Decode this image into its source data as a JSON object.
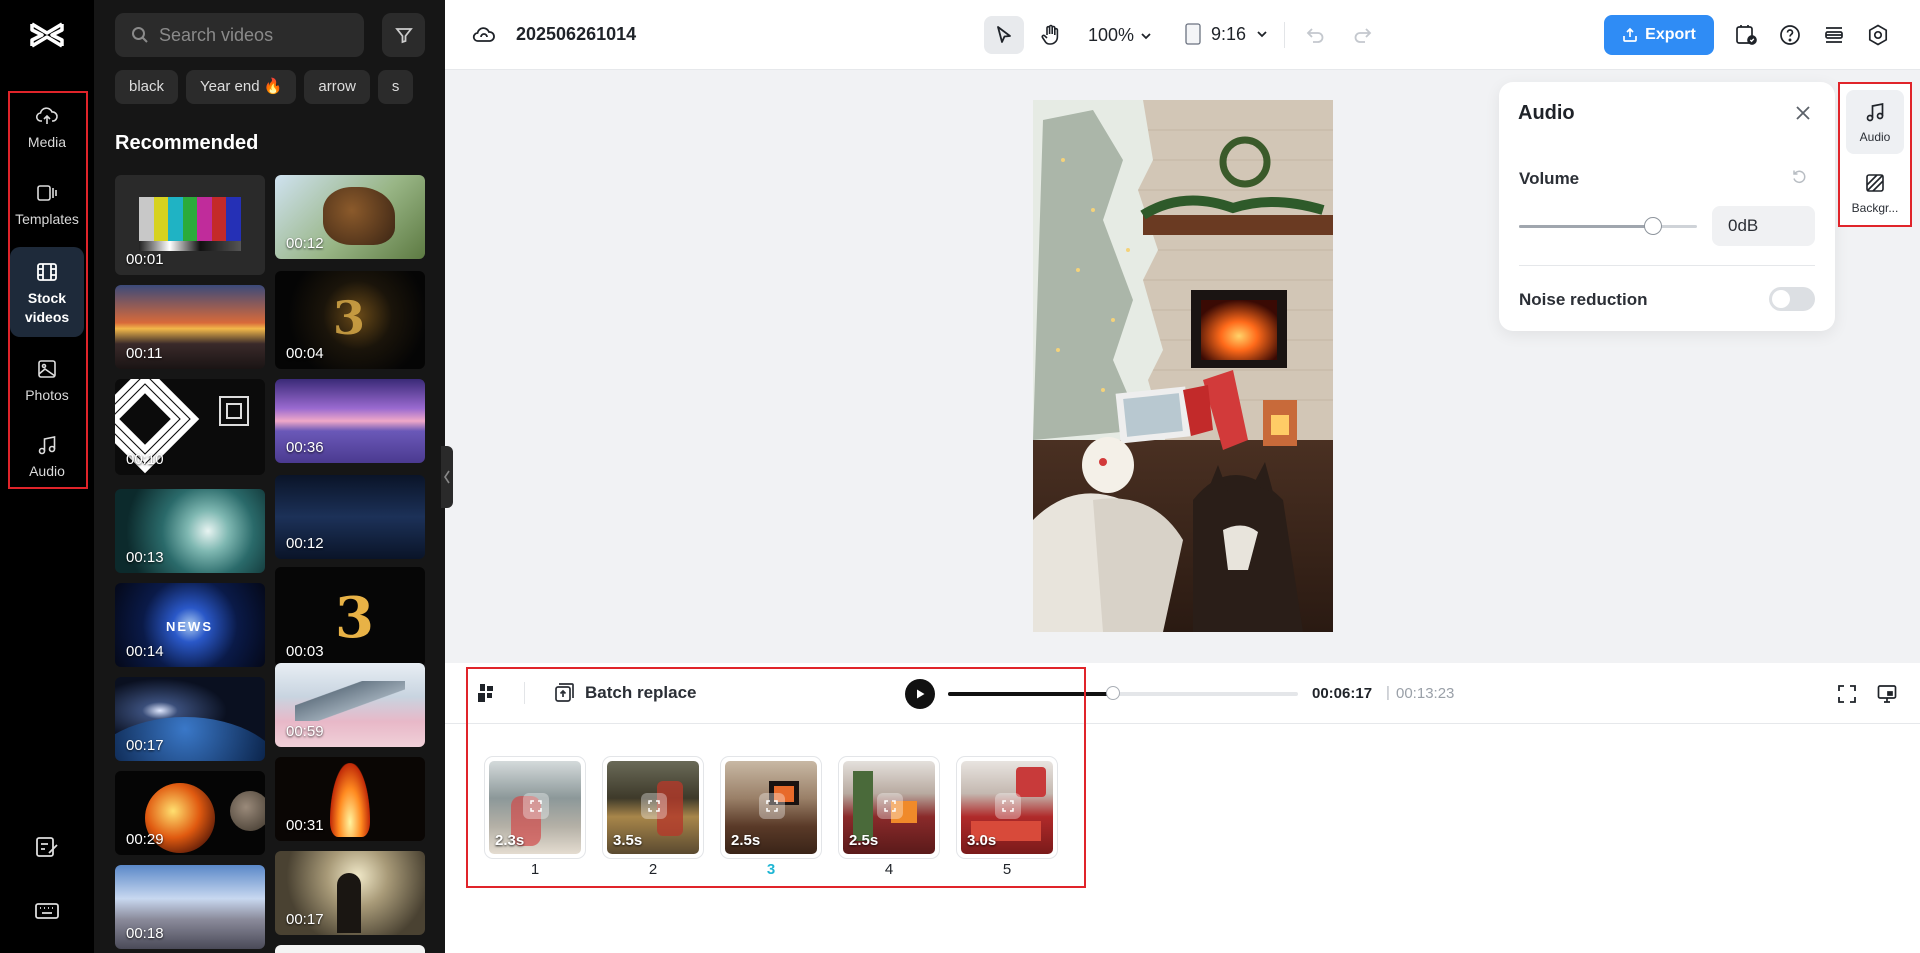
{
  "rail": {
    "items": [
      {
        "label": "Media",
        "icon": "cloud-upload-icon"
      },
      {
        "label": "Templates",
        "icon": "templates-icon"
      },
      {
        "label": "Stock\nvideos",
        "icon": "film-icon"
      },
      {
        "label": "Photos",
        "icon": "image-icon"
      },
      {
        "label": "Audio",
        "icon": "music-note-icon"
      }
    ],
    "active": "Stock videos"
  },
  "panel": {
    "search_placeholder": "Search videos",
    "chips": [
      "black",
      "Year end 🔥",
      "arrow",
      "s"
    ],
    "section_title": "Recommended",
    "videos": [
      {
        "duration": "00:01"
      },
      {
        "duration": "00:12"
      },
      {
        "duration": "00:11"
      },
      {
        "duration": "00:04"
      },
      {
        "duration": "00:10"
      },
      {
        "duration": "00:36"
      },
      {
        "duration": "00:13"
      },
      {
        "duration": "00:12"
      },
      {
        "duration": "00:14"
      },
      {
        "duration": "00:03"
      },
      {
        "duration": "00:17"
      },
      {
        "duration": "00:59"
      },
      {
        "duration": "00:29"
      },
      {
        "duration": "00:31"
      },
      {
        "duration": "00:18"
      },
      {
        "duration": "00:17"
      }
    ]
  },
  "topbar": {
    "project_name": "202506261014",
    "zoom": "100%",
    "ratio": "9:16",
    "export_label": "Export",
    "accent": "#2f8cf5"
  },
  "audio_panel": {
    "title": "Audio",
    "volume_label": "Volume",
    "volume_value": "0dB",
    "volume_slider_fraction": 0.75,
    "noise_label": "Noise reduction",
    "noise_enabled": false
  },
  "prop_tabs": [
    {
      "label": "Audio",
      "icon": "music-note-icon",
      "active": true
    },
    {
      "label": "Backgr...",
      "icon": "background-icon",
      "active": false
    }
  ],
  "timeline": {
    "batch_label": "Batch replace",
    "current_time": "00:06:17",
    "separator": "|",
    "total_time": "00:13:23",
    "progress_fraction": 0.47,
    "clips": [
      {
        "length": "2.3s",
        "number": "1"
      },
      {
        "length": "3.5s",
        "number": "2"
      },
      {
        "length": "2.5s",
        "number": "3",
        "active": true
      },
      {
        "length": "2.5s",
        "number": "4"
      },
      {
        "length": "3.0s",
        "number": "5"
      }
    ]
  }
}
